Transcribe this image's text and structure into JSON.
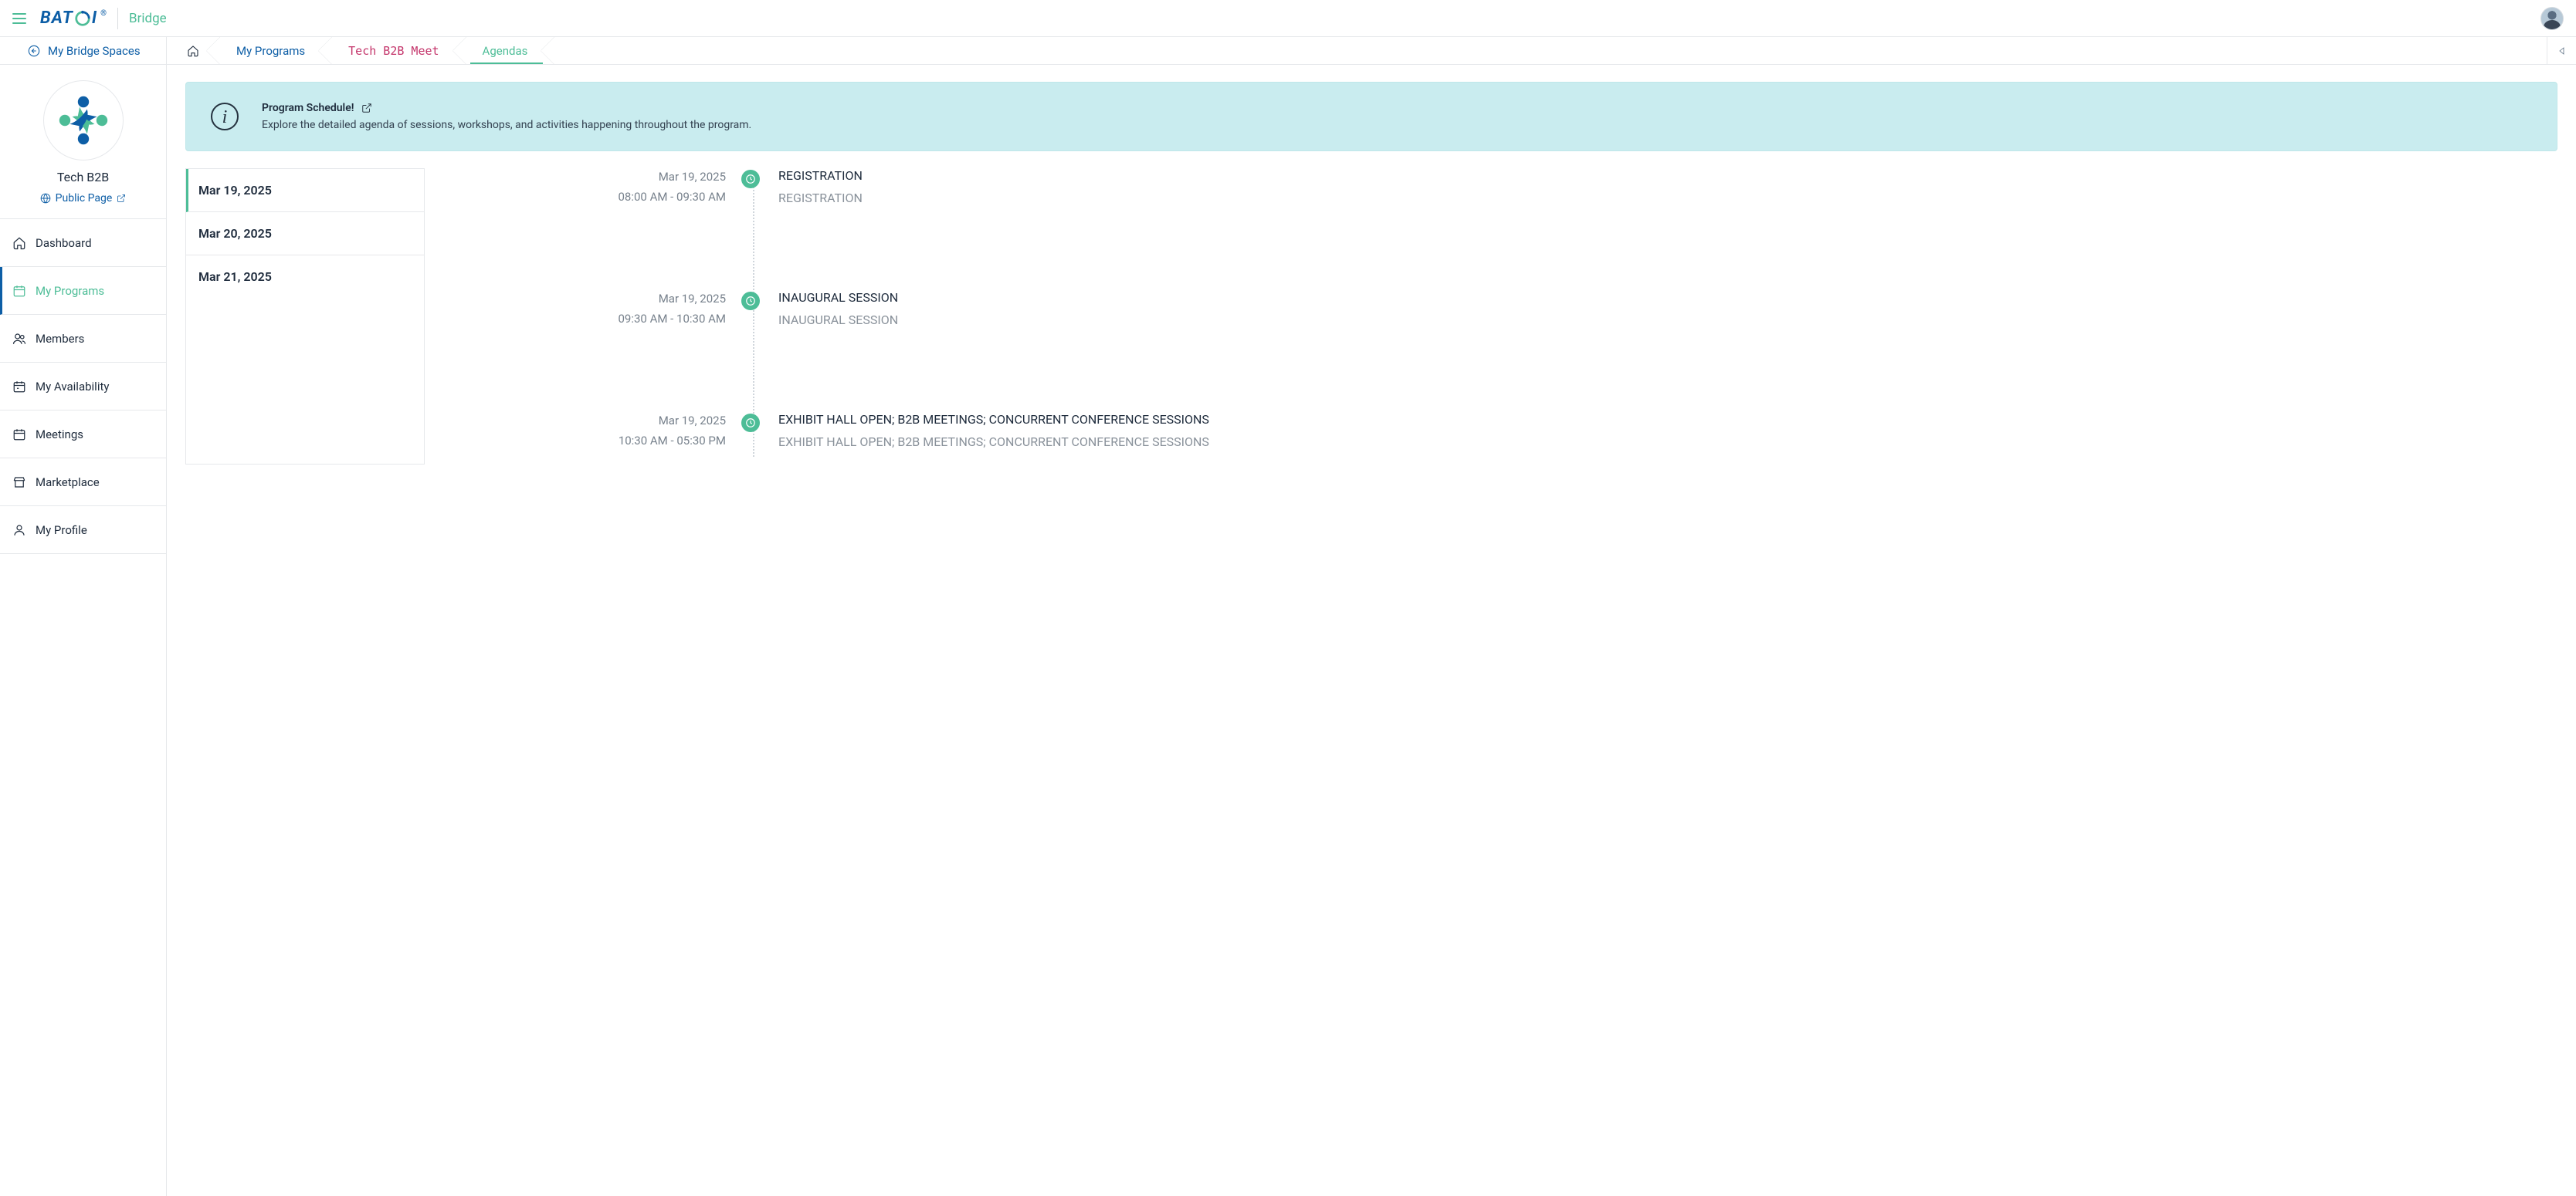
{
  "header": {
    "brand_name": "BATOI",
    "app_name": "Bridge"
  },
  "breadcrumb": {
    "back_label": "My Bridge Spaces",
    "items": [
      {
        "label": "My Programs",
        "style": "link"
      },
      {
        "label": "Tech B2B Meet",
        "style": "mono"
      },
      {
        "label": "Agendas",
        "style": "active"
      }
    ]
  },
  "space": {
    "title": "Tech B2B",
    "public_link_label": "Public Page"
  },
  "sidebar": {
    "items": [
      {
        "label": "Dashboard",
        "icon": "home-icon"
      },
      {
        "label": "My Programs",
        "icon": "calendar-icon",
        "active": true
      },
      {
        "label": "Members",
        "icon": "members-icon"
      },
      {
        "label": "My Availability",
        "icon": "availability-icon"
      },
      {
        "label": "Meetings",
        "icon": "meetings-icon"
      },
      {
        "label": "Marketplace",
        "icon": "marketplace-icon"
      },
      {
        "label": "My Profile",
        "icon": "profile-icon"
      }
    ]
  },
  "banner": {
    "title": "Program Schedule!",
    "desc": "Explore the detailed agenda of sessions, workshops, and activities happening throughout the program."
  },
  "dates": [
    {
      "label": "Mar 19, 2025",
      "active": true
    },
    {
      "label": "Mar 20, 2025"
    },
    {
      "label": "Mar 21, 2025"
    }
  ],
  "events": [
    {
      "date": "Mar 19, 2025",
      "time": "08:00 AM - 09:30 AM",
      "title": "REGISTRATION",
      "subtitle": "REGISTRATION"
    },
    {
      "date": "Mar 19, 2025",
      "time": "09:30 AM - 10:30 AM",
      "title": "INAUGURAL SESSION",
      "subtitle": "INAUGURAL SESSION"
    },
    {
      "date": "Mar 19, 2025",
      "time": "10:30 AM - 05:30 PM",
      "title": "EXHIBIT HALL OPEN; B2B MEETINGS; CONCURRENT CONFERENCE SESSIONS",
      "subtitle": "EXHIBIT HALL OPEN; B2B MEETINGS; CONCURRENT CONFERENCE SESSIONS"
    }
  ]
}
